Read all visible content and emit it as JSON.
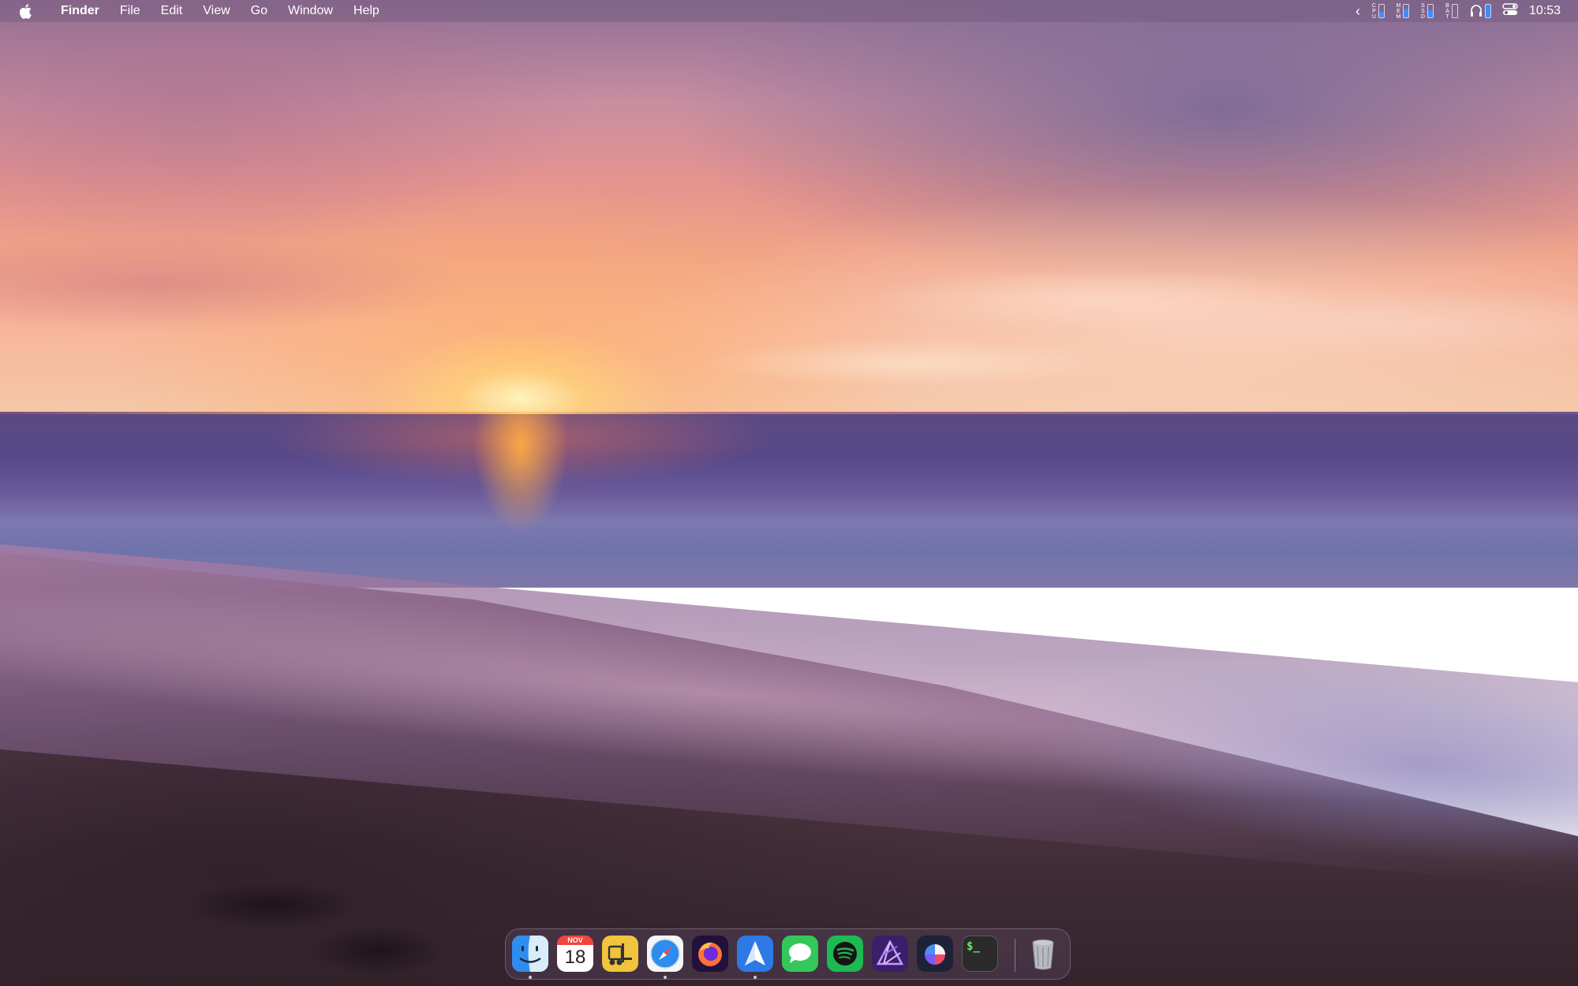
{
  "menubar": {
    "apple": "apple-logo-icon",
    "app_name": "Finder",
    "items": [
      "File",
      "Edit",
      "View",
      "Go",
      "Window",
      "Help"
    ],
    "status": {
      "collapse_arrow": "‹",
      "cpu_label": "CPU",
      "mem_label": "MEM",
      "ssd_label": "SSD",
      "bat_label": "BAT",
      "cpu_level": 0.45,
      "mem_level": 0.7,
      "ssd_level": 0.55,
      "bat_level": 0.0,
      "headphones": "headphones-icon",
      "control_center": "control-center-icon",
      "clock": "10:53"
    }
  },
  "dock": {
    "apps": [
      {
        "name": "Finder",
        "running": true
      },
      {
        "name": "Calendar",
        "month": "NOV",
        "day": "18",
        "running": false
      },
      {
        "name": "Forklift",
        "running": false
      },
      {
        "name": "Safari",
        "running": true
      },
      {
        "name": "Firefox",
        "running": false
      },
      {
        "name": "Spark",
        "running": true
      },
      {
        "name": "Messages",
        "running": false
      },
      {
        "name": "Spotify",
        "running": false
      },
      {
        "name": "Affinity Photo",
        "running": false
      },
      {
        "name": "Craft",
        "running": false
      },
      {
        "name": "Terminal",
        "terminal_text": "$_",
        "running": false
      }
    ],
    "trash": "Trash"
  },
  "colors": {
    "meter_fill": "#3f8cff",
    "menubar_bg": "rgba(120,92,128,0.55)"
  }
}
